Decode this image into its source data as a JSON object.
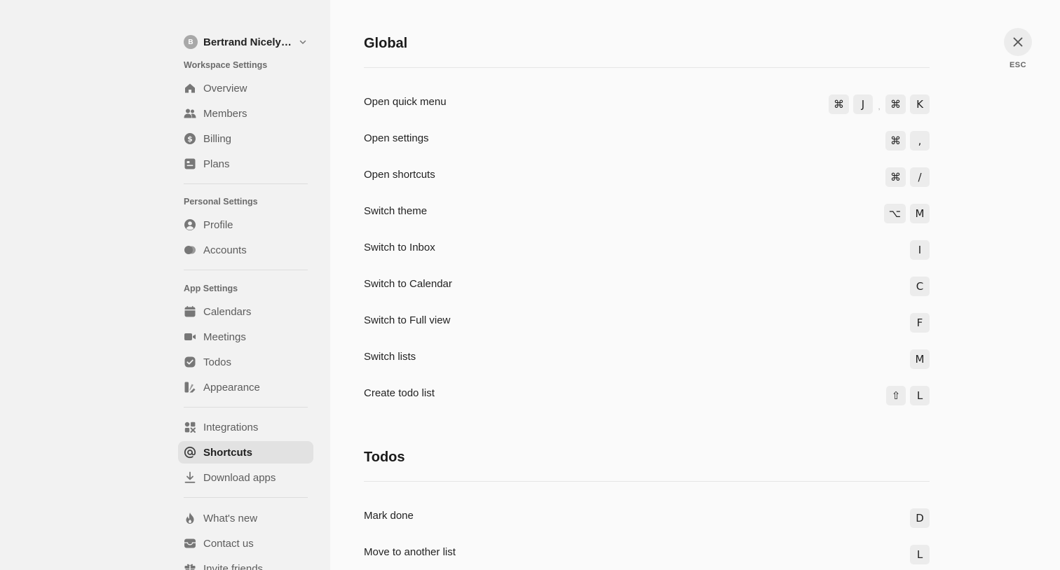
{
  "account": {
    "initial": "B",
    "name": "Bertrand Nicelyd..."
  },
  "sidebar": {
    "workspace_label": "Workspace Settings",
    "workspace_items": [
      {
        "label": "Overview",
        "icon": "home-icon"
      },
      {
        "label": "Members",
        "icon": "people-icon"
      },
      {
        "label": "Billing",
        "icon": "dollar-icon"
      },
      {
        "label": "Plans",
        "icon": "plans-icon"
      }
    ],
    "personal_label": "Personal Settings",
    "personal_items": [
      {
        "label": "Profile",
        "icon": "user-circle-icon"
      },
      {
        "label": "Accounts",
        "icon": "accounts-icon"
      }
    ],
    "app_label": "App Settings",
    "app_items": [
      {
        "label": "Calendars",
        "icon": "calendar-icon"
      },
      {
        "label": "Meetings",
        "icon": "video-icon"
      },
      {
        "label": "Todos",
        "icon": "check-circle-icon"
      },
      {
        "label": "Appearance",
        "icon": "palette-icon"
      }
    ],
    "misc_items": [
      {
        "label": "Integrations",
        "icon": "integrations-icon"
      },
      {
        "label": "Shortcuts",
        "icon": "at-icon",
        "active": true
      },
      {
        "label": "Download apps",
        "icon": "download-icon"
      }
    ],
    "support_items": [
      {
        "label": "What's new",
        "icon": "flame-icon"
      },
      {
        "label": "Contact us",
        "icon": "inbox-icon"
      },
      {
        "label": "Invite friends",
        "icon": "gift-icon"
      }
    ]
  },
  "close": {
    "esc_label": "ESC"
  },
  "sections": {
    "global": {
      "title": "Global",
      "rows": [
        {
          "label": "Open quick menu",
          "keys": [
            "⌘",
            "J"
          ],
          "alt_keys": [
            "⌘",
            "K"
          ],
          "sep": ","
        },
        {
          "label": "Open settings",
          "keys": [
            "⌘",
            ","
          ]
        },
        {
          "label": "Open shortcuts",
          "keys": [
            "⌘",
            "/"
          ]
        },
        {
          "label": "Switch theme",
          "keys": [
            "⌥",
            "M"
          ]
        },
        {
          "label": "Switch to Inbox",
          "keys": [
            "I"
          ]
        },
        {
          "label": "Switch to Calendar",
          "keys": [
            "C"
          ]
        },
        {
          "label": "Switch to Full view",
          "keys": [
            "F"
          ]
        },
        {
          "label": "Switch lists",
          "keys": [
            "M"
          ]
        },
        {
          "label": "Create todo list",
          "keys": [
            "⇧",
            "L"
          ]
        }
      ]
    },
    "todos": {
      "title": "Todos",
      "rows": [
        {
          "label": "Mark done",
          "keys": [
            "D"
          ]
        },
        {
          "label": "Move to another list",
          "keys": [
            "L"
          ]
        }
      ]
    }
  }
}
